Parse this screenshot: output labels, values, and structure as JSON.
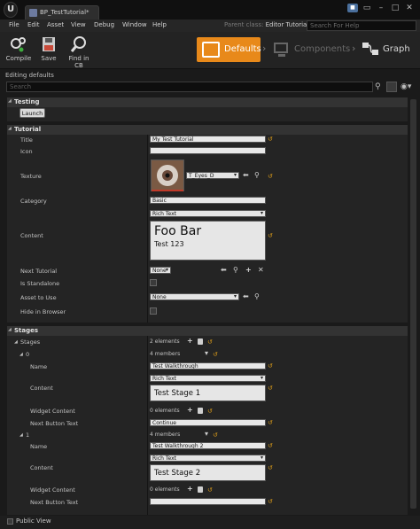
{
  "window": {
    "tab_title": "BP_TestTutorial",
    "tab_modified": "*",
    "parent_class_label": "Parent class:",
    "parent_class_value": "Editor Tutorial.h",
    "help_search_placeholder": "Search For Help"
  },
  "menu": [
    "File",
    "Edit",
    "Asset",
    "View",
    "Debug",
    "Window",
    "Help"
  ],
  "toolbar": {
    "compile_label": "Compile",
    "save_label": "Save",
    "find_label": "Find in CB"
  },
  "modes": {
    "defaults": "Defaults",
    "components": "Components",
    "graph": "Graph"
  },
  "details": {
    "editing_label": "Editing defaults",
    "search_placeholder": "Search"
  },
  "testing": {
    "header": "Testing",
    "launch_button": "Launch"
  },
  "tutorial": {
    "header": "Tutorial",
    "title_label": "Title",
    "title_value": "My Test Tutorial",
    "icon_label": "Icon",
    "icon_value": "",
    "texture_label": "Texture",
    "texture_value": "T_Eyes_D",
    "category_label": "Category",
    "category_value": "Basic",
    "content_label": "Content",
    "content_type": "Rich Text",
    "content_heading": "Foo Bar",
    "content_body": "Test 123",
    "next_tutorial_label": "Next Tutorial",
    "next_tutorial_value": "None",
    "is_standalone_label": "Is Standalone",
    "asset_to_use_label": "Asset to Use",
    "asset_to_use_value": "None",
    "hide_in_browser_label": "Hide in Browser"
  },
  "stages": {
    "header": "Stages",
    "stages_label": "Stages",
    "stages_count": "2 elements",
    "items": [
      {
        "index": "0",
        "members": "4 members",
        "name_label": "Name",
        "name_value": "Test Walkthrough",
        "content_label": "Content",
        "content_type": "Rich Text",
        "content_text": "Test Stage 1",
        "widget_label": "Widget Content",
        "widget_count": "0 elements",
        "next_label": "Next Button Text",
        "next_value": "Continue"
      },
      {
        "index": "1",
        "members": "4 members",
        "name_label": "Name",
        "name_value": "Test Walkthrough 2",
        "content_label": "Content",
        "content_type": "Rich Text",
        "content_text": "Test Stage 2",
        "widget_label": "Widget Content",
        "widget_count": "0 elements",
        "next_label": "Next Button Text",
        "next_value": ""
      }
    ]
  },
  "footer": {
    "public_view_label": "Public View"
  },
  "colors": {
    "accent": "#e8891a",
    "reset_arrow": "#d89a1a"
  }
}
